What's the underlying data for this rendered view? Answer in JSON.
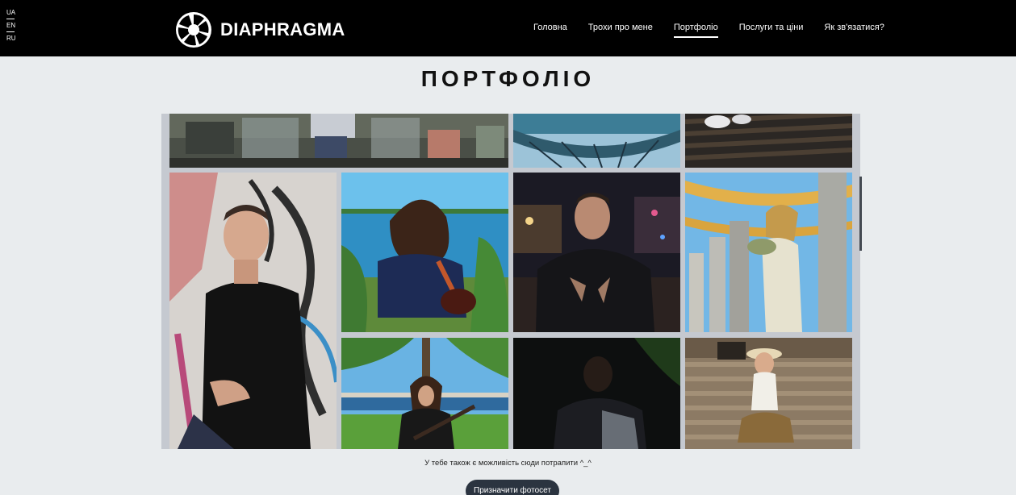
{
  "languages": [
    "UA",
    "EN",
    "RU"
  ],
  "brand": {
    "name": "DIAPHRAGMA",
    "logo_icon": "aperture-icon"
  },
  "nav": {
    "items": [
      {
        "label": "Головна",
        "active": false
      },
      {
        "label": "Трохи про мене",
        "active": false
      },
      {
        "label": "Портфоліо",
        "active": true
      },
      {
        "label": "Послуги та ціни",
        "active": false
      },
      {
        "label": "Як зв'язатися?",
        "active": false
      }
    ]
  },
  "page": {
    "title": "ПОРТФОЛІО"
  },
  "gallery": {
    "photos": [
      {
        "subject": "fountain-street"
      },
      {
        "subject": "metal-canopy"
      },
      {
        "subject": "bench-feet"
      },
      {
        "subject": "man-graffiti-wall"
      },
      {
        "subject": "guitarist-back-lake"
      },
      {
        "subject": "man-night-city"
      },
      {
        "subject": "woman-columns"
      },
      {
        "subject": "guitarist-lake"
      },
      {
        "subject": "man-dark-night"
      },
      {
        "subject": "woman-hat-stairs"
      }
    ]
  },
  "caption": "У тебе також є можливість сюди потрапити ^_^",
  "cta": {
    "label": "Призначити фотосет"
  },
  "colors": {
    "header_bg": "#000000",
    "page_bg": "#e9ecee",
    "button_bg": "#2b3440"
  }
}
